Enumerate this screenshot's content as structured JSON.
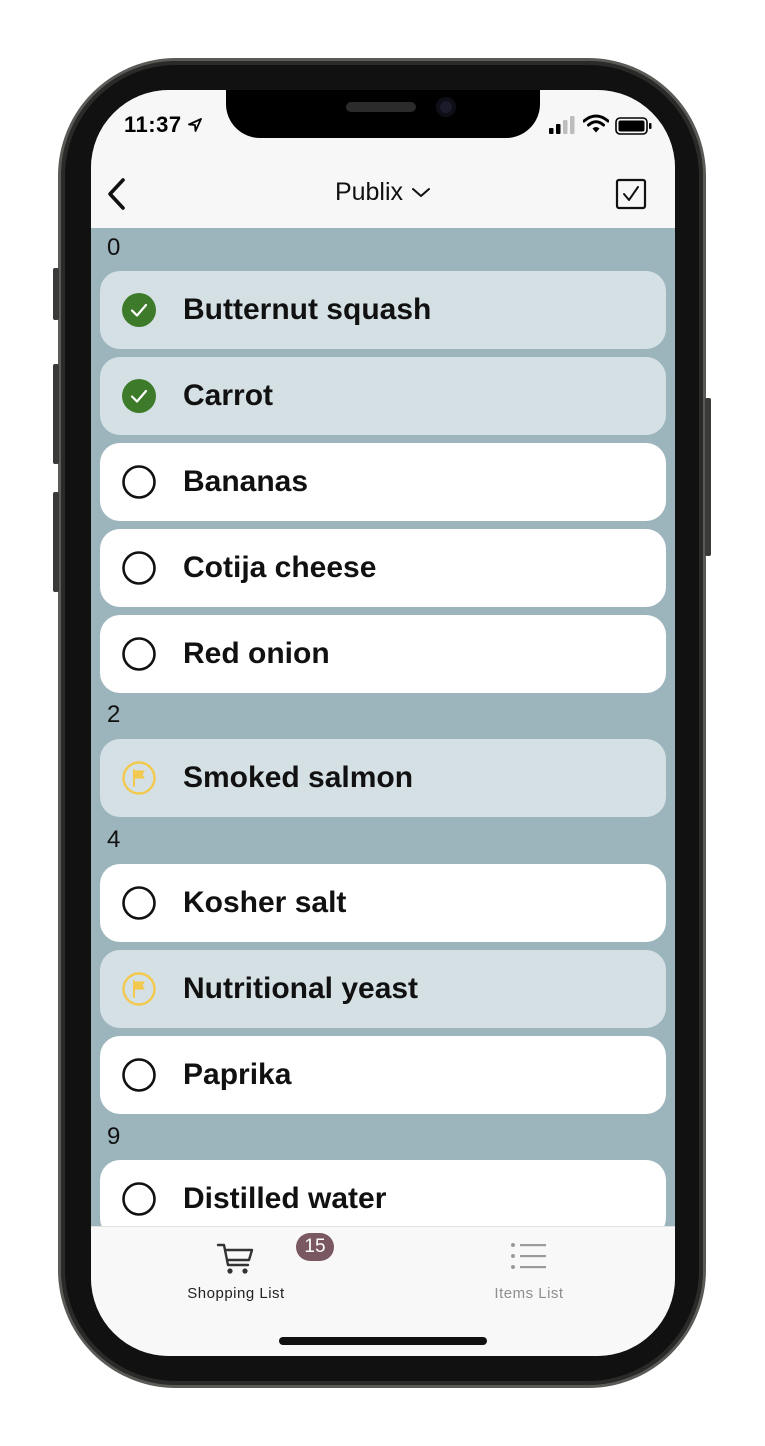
{
  "status_bar": {
    "time": "11:37"
  },
  "nav": {
    "title": "Publix",
    "back_icon": "chevron-left-icon",
    "title_icon": "chevron-down-icon",
    "action_icon": "checkbox-icon"
  },
  "colors": {
    "list_background": "#9cb5bd",
    "checked_row": "#d5e0e4",
    "check_green": "#3d7a2a",
    "flag_yellow": "#f2c94c",
    "badge": "#7a5862"
  },
  "sections": [
    {
      "header": "0",
      "items": [
        {
          "label": "Butternut squash",
          "state": "checked"
        },
        {
          "label": "Carrot",
          "state": "checked"
        },
        {
          "label": "Bananas",
          "state": "unchecked"
        },
        {
          "label": "Cotija cheese",
          "state": "unchecked"
        },
        {
          "label": "Red onion",
          "state": "unchecked"
        }
      ]
    },
    {
      "header": "2",
      "items": [
        {
          "label": "Smoked salmon",
          "state": "flagged"
        }
      ]
    },
    {
      "header": "4",
      "items": [
        {
          "label": "Kosher salt",
          "state": "unchecked"
        },
        {
          "label": "Nutritional yeast",
          "state": "flagged"
        },
        {
          "label": "Paprika",
          "state": "unchecked"
        }
      ]
    },
    {
      "header": "9",
      "items": [
        {
          "label": "Distilled water",
          "state": "unchecked"
        }
      ]
    }
  ],
  "tabs": [
    {
      "label": "Shopping List",
      "icon": "cart-icon",
      "badge": "15",
      "active": true
    },
    {
      "label": "Items List",
      "icon": "list-icon",
      "active": false
    }
  ]
}
